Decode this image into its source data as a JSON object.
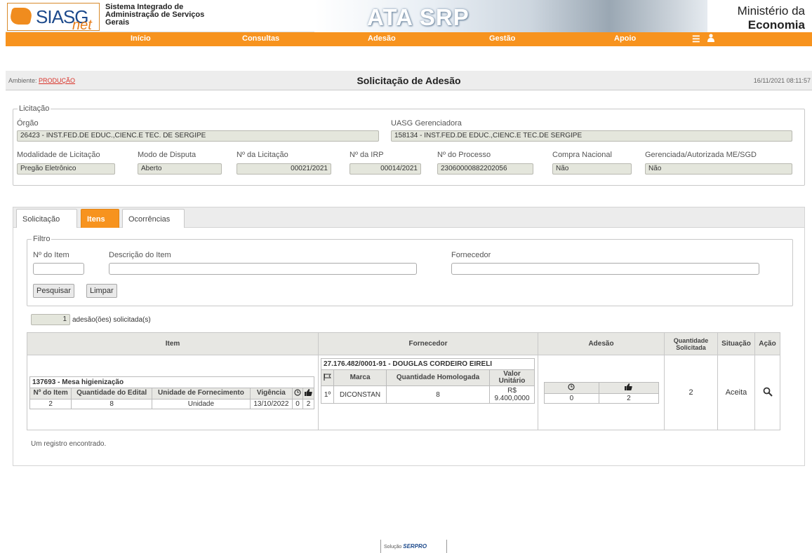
{
  "header": {
    "logo_text": "SIASG",
    "logo_suffix": "net",
    "system_name": "Sistema Integrado de Administração de Serviços Gerais",
    "banner_title": "ATA SRP",
    "ministry_line1": "Ministério da",
    "ministry_line2": "Economia"
  },
  "nav": {
    "items": [
      "Início",
      "Consultas",
      "Adesão",
      "Gestão",
      "Apoio"
    ],
    "menu_icon": "menu-icon",
    "user_icon": "user-icon"
  },
  "titlebar": {
    "env_label": "Ambiente: ",
    "env_value": "PRODUÇÃO",
    "page_title": "Solicitação de Adesão",
    "timestamp": "16/11/2021 08:11:57"
  },
  "licitacao": {
    "legend": "Licitação",
    "orgao_label": "Órgão",
    "orgao_value": "26423 - INST.FED.DE EDUC.,CIENC.E TEC. DE SERGIPE",
    "uasg_label": "UASG Gerenciadora",
    "uasg_value": "158134 - INST.FED.DE EDUC.,CIENC.E TEC.DE SERGIPE",
    "modalidade_label": "Modalidade de Licitação",
    "modalidade_value": "Pregão Eletrônico",
    "modo_label": "Modo de Disputa",
    "modo_value": "Aberto",
    "num_licitacao_label": "Nº da Licitação",
    "num_licitacao_value": "00021/2021",
    "num_irp_label": "Nº da IRP",
    "num_irp_value": "00014/2021",
    "num_processo_label": "Nº do Processo",
    "num_processo_value": "23060000882202056",
    "compra_label": "Compra Nacional",
    "compra_value": "Não",
    "gerenciada_label": "Gerenciada/Autorizada ME/SGD",
    "gerenciada_value": "Não"
  },
  "tabs": [
    "Solicitação",
    "Itens",
    "Ocorrências"
  ],
  "filtro": {
    "legend": "Filtro",
    "item_label": "Nº do Item",
    "desc_label": "Descrição do Item",
    "fornecedor_label": "Fornecedor",
    "search_button": "Pesquisar",
    "clear_button": "Limpar"
  },
  "summary": {
    "count": "1",
    "label": "adesão(ões) solicitada(s)"
  },
  "table": {
    "headers": {
      "item": "Item",
      "fornecedor": "Fornecedor",
      "adesao": "Adesão",
      "quantidade": "Quantidade Solicitada",
      "situacao": "Situação",
      "acao": "Ação"
    },
    "item_caption": "137693 - Mesa higienização",
    "item_headers": [
      "Nº do Item",
      "Quantidade do Edital",
      "Unidade de Fornecimento",
      "Vigência"
    ],
    "item_row": [
      "2",
      "8",
      "Unidade",
      "13/10/2022",
      "0",
      "2"
    ],
    "fornecedor_caption": "27.176.482/0001-91 - DOUGLAS CORDEIRO EIRELI",
    "fornecedor_headers": [
      "Marca",
      "Quantidade Homologada",
      "Valor Unitário"
    ],
    "fornecedor_row": [
      "1º",
      "DICONSTAN",
      "8",
      "R$ 9.400,0000"
    ],
    "adesao_row": [
      "0",
      "2"
    ],
    "quantidade_solicitada": "2",
    "situacao": "Aceita"
  },
  "result_message": "Um registro encontrado.",
  "footer": {
    "solucao": "Solução",
    "brand": "SERPRO"
  }
}
